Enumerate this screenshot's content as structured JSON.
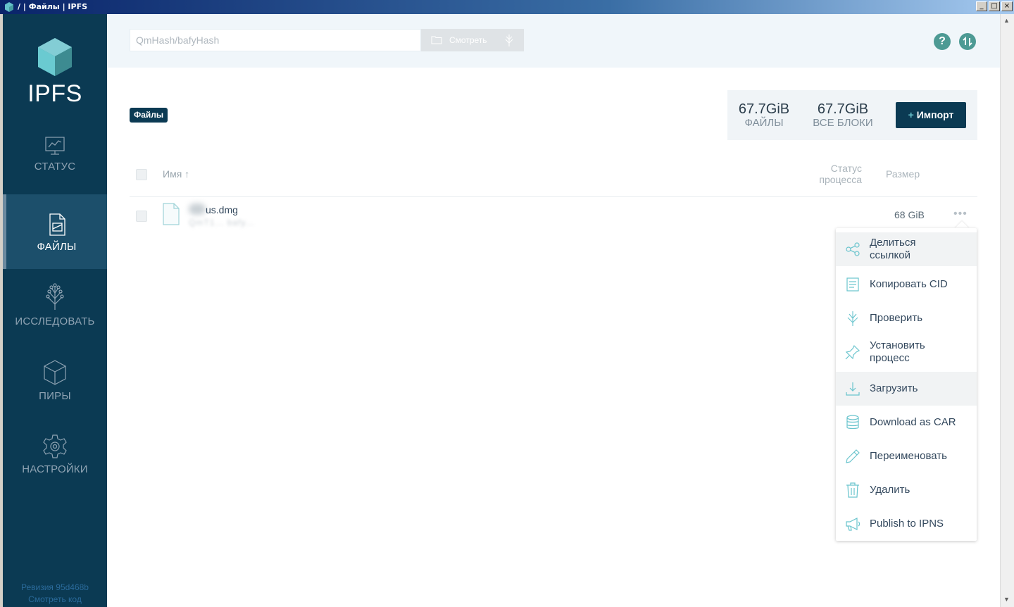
{
  "window": {
    "title": "/ | Файлы | IPFS",
    "buttons": [
      "_",
      "□",
      "×"
    ]
  },
  "sidebar": {
    "logo_text": "IPFS",
    "items": [
      {
        "label": "СТАТУС",
        "icon": "status-icon",
        "active": false
      },
      {
        "label": "ФАЙЛЫ",
        "icon": "files-icon",
        "active": true
      },
      {
        "label": "ИССЛЕДОВАТЬ",
        "icon": "explore-icon",
        "active": false
      },
      {
        "label": "ПИРЫ",
        "icon": "peers-icon",
        "active": false
      },
      {
        "label": "НАСТРОЙКИ",
        "icon": "settings-icon",
        "active": false
      }
    ],
    "footer": {
      "revision": "Ревизия 95d468b",
      "view_code": "Смотреть код"
    }
  },
  "header": {
    "search_placeholder": "QmHash/bafyHash",
    "browse_label": "Смотреть"
  },
  "breadcrumb": "Файлы",
  "stats": {
    "files_value": "67.7GiB",
    "files_label": "ФАЙЛЫ",
    "blocks_value": "67.7GiB",
    "blocks_label": "ВСЕ БЛОКИ",
    "import_label": "Импорт",
    "import_plus": "+"
  },
  "table": {
    "col_name": "Имя ↑",
    "col_status_line1": "Статус",
    "col_status_line2": "процесса",
    "col_size": "Размер",
    "rows": [
      {
        "name": "us.dmg",
        "cid": "QmT1... bafy...",
        "size": "68 GiB",
        "more": "•••"
      }
    ]
  },
  "context_menu": {
    "items": [
      {
        "label_line1": "Делиться",
        "label_line2": "ссылкой",
        "icon": "share-icon"
      },
      {
        "label": "Копировать CID",
        "icon": "copy-icon"
      },
      {
        "label": "Проверить",
        "icon": "inspect-icon"
      },
      {
        "label_line1": "Установить",
        "label_line2": "процесс",
        "icon": "pin-icon"
      },
      {
        "label": "Загрузить",
        "icon": "download-icon"
      },
      {
        "label": "Download as CAR",
        "icon": "database-icon"
      },
      {
        "label": "Переименовать",
        "icon": "pencil-icon"
      },
      {
        "label": "Удалить",
        "icon": "trash-icon"
      },
      {
        "label": "Publish to IPNS",
        "icon": "megaphone-icon"
      }
    ]
  },
  "colors": {
    "sidebar_bg": "#0b3a53",
    "sidebar_active": "#1c4f6b",
    "accent_teal": "#4d9a94",
    "header_bg": "#f0f6fa"
  }
}
